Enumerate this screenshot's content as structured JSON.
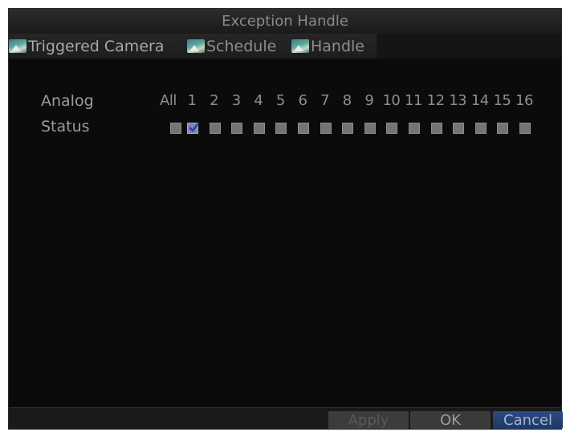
{
  "window": {
    "title": "Exception Handle"
  },
  "tabs": [
    {
      "label": "Triggered Camera",
      "active": true,
      "icon": "picture-icon"
    },
    {
      "label": "Schedule",
      "active": false,
      "icon": "picture-icon"
    },
    {
      "label": "Handle",
      "active": false,
      "icon": "picture-icon"
    }
  ],
  "grid": {
    "row_analog_label": "Analog",
    "row_status_label": "Status",
    "all_label": "All",
    "channels": [
      "1",
      "2",
      "3",
      "4",
      "5",
      "6",
      "7",
      "8",
      "9",
      "10",
      "11",
      "12",
      "13",
      "14",
      "15",
      "16"
    ],
    "checked": [
      false,
      true,
      false,
      false,
      false,
      false,
      false,
      false,
      false,
      false,
      false,
      false,
      false,
      false,
      false,
      false,
      false
    ]
  },
  "footer": {
    "apply_label": "Apply",
    "ok_label": "OK",
    "cancel_label": "Cancel"
  },
  "colors": {
    "background": "#0b0b0b",
    "checkbox": "#747474",
    "checkbox_checked": "#7e85b6",
    "cancel_button": "#2c4b83"
  }
}
